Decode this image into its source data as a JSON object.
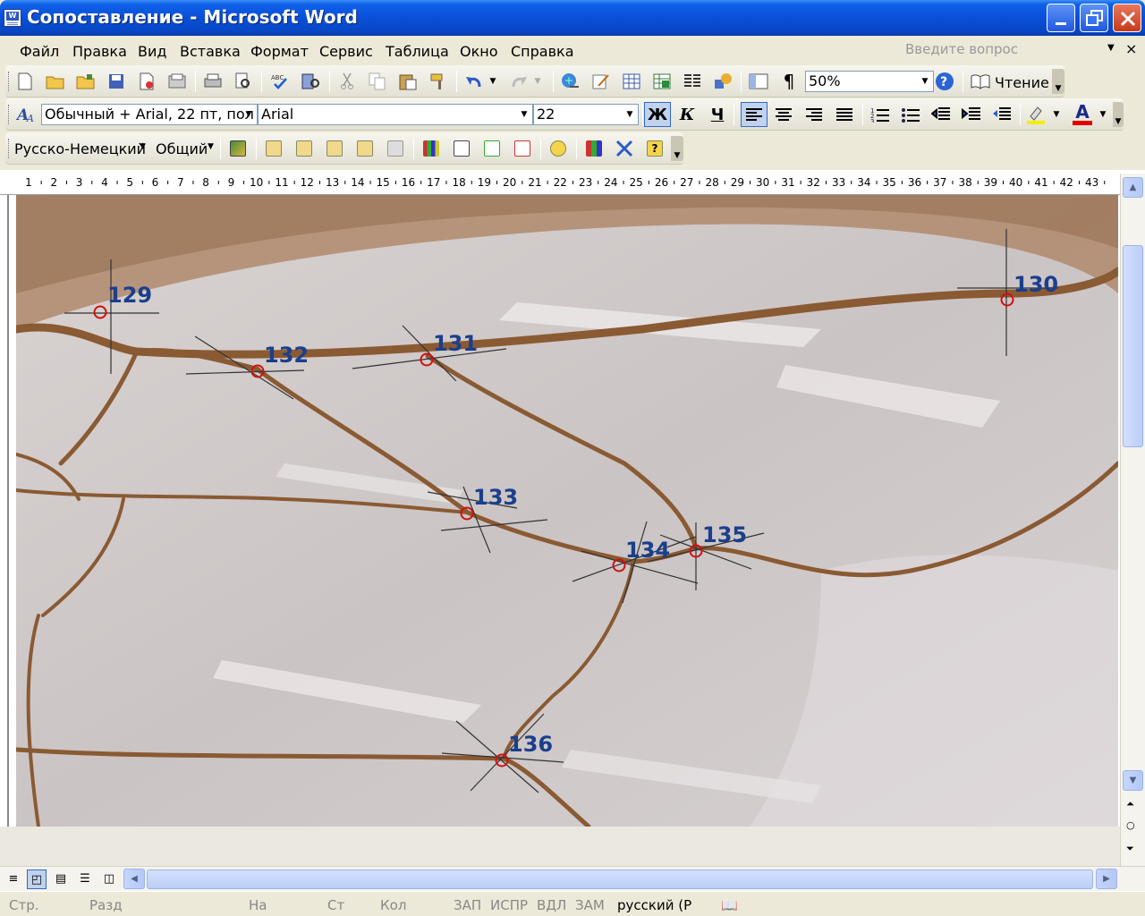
{
  "window": {
    "title": "Сопоставление - Microsoft Word",
    "app_icon_letter": "W"
  },
  "menu": {
    "items": [
      "Файл",
      "Правка",
      "Вид",
      "Вставка",
      "Формат",
      "Сервис",
      "Таблица",
      "Окно",
      "Справка"
    ],
    "help_placeholder": "Введите вопрос",
    "close_glyph": "×"
  },
  "standard_toolbar": {
    "zoom": "50%",
    "read_label": "Чтение",
    "icons": [
      "new-document-icon",
      "open-icon",
      "open-folder-icon",
      "save-icon",
      "permission-icon",
      "save-as-icon",
      "print-icon",
      "print-preview-icon",
      "spelling-icon",
      "research-icon",
      "cut-icon",
      "copy-icon",
      "paste-icon",
      "format-painter-icon",
      "undo-icon",
      "redo-icon",
      "hyperlink-icon",
      "drawing-icon",
      "insert-table-icon",
      "insert-excel-icon",
      "columns-icon",
      "drawing-toolbar-icon",
      "document-map-icon",
      "show-paragraph-icon",
      "help-icon",
      "read-mode-icon"
    ]
  },
  "format_toolbar": {
    "style": "Обычный + Arial, 22 пт, пол",
    "font": "Arial",
    "size": "22",
    "bold_label": "Ж",
    "italic_label": "К",
    "underline_label": "Ч",
    "font_color_label": "А",
    "colors": {
      "highlight": "#f0f000",
      "font_color": "#e00000"
    }
  },
  "lang_toolbar": {
    "dictionary": "Русско-Немецкий",
    "topic": "Общий"
  },
  "ruler": {
    "labels": [
      "1",
      "2",
      "3",
      "4",
      "5",
      "6",
      "7",
      "8",
      "9",
      "10",
      "11",
      "12",
      "13",
      "14",
      "15",
      "16",
      "17",
      "18",
      "19",
      "20",
      "21",
      "22",
      "23",
      "24",
      "25",
      "26",
      "27",
      "28",
      "29",
      "30",
      "31",
      "32",
      "33",
      "34",
      "35",
      "36",
      "37",
      "38",
      "39",
      "40",
      "41",
      "42",
      "43"
    ]
  },
  "document": {
    "landmarks": [
      {
        "label": "129"
      },
      {
        "label": "130"
      },
      {
        "label": "131"
      },
      {
        "label": "132"
      },
      {
        "label": "133"
      },
      {
        "label": "134"
      },
      {
        "label": "135"
      },
      {
        "label": "136"
      }
    ],
    "colors": {
      "marker_label": "#1a3f8c",
      "marker_circle": "#d01010",
      "vein": "#8a5a33",
      "wing_bg": "#cfc8c8"
    }
  },
  "statusbar": {
    "page": "Стр.",
    "section": "Разд",
    "at": "На",
    "line": "Ст",
    "col": "Кол",
    "rec": "ЗАП",
    "trk": "ИСПР",
    "ext": "ВДЛ",
    "ovr": "ЗАМ",
    "language": "русский (Р"
  }
}
